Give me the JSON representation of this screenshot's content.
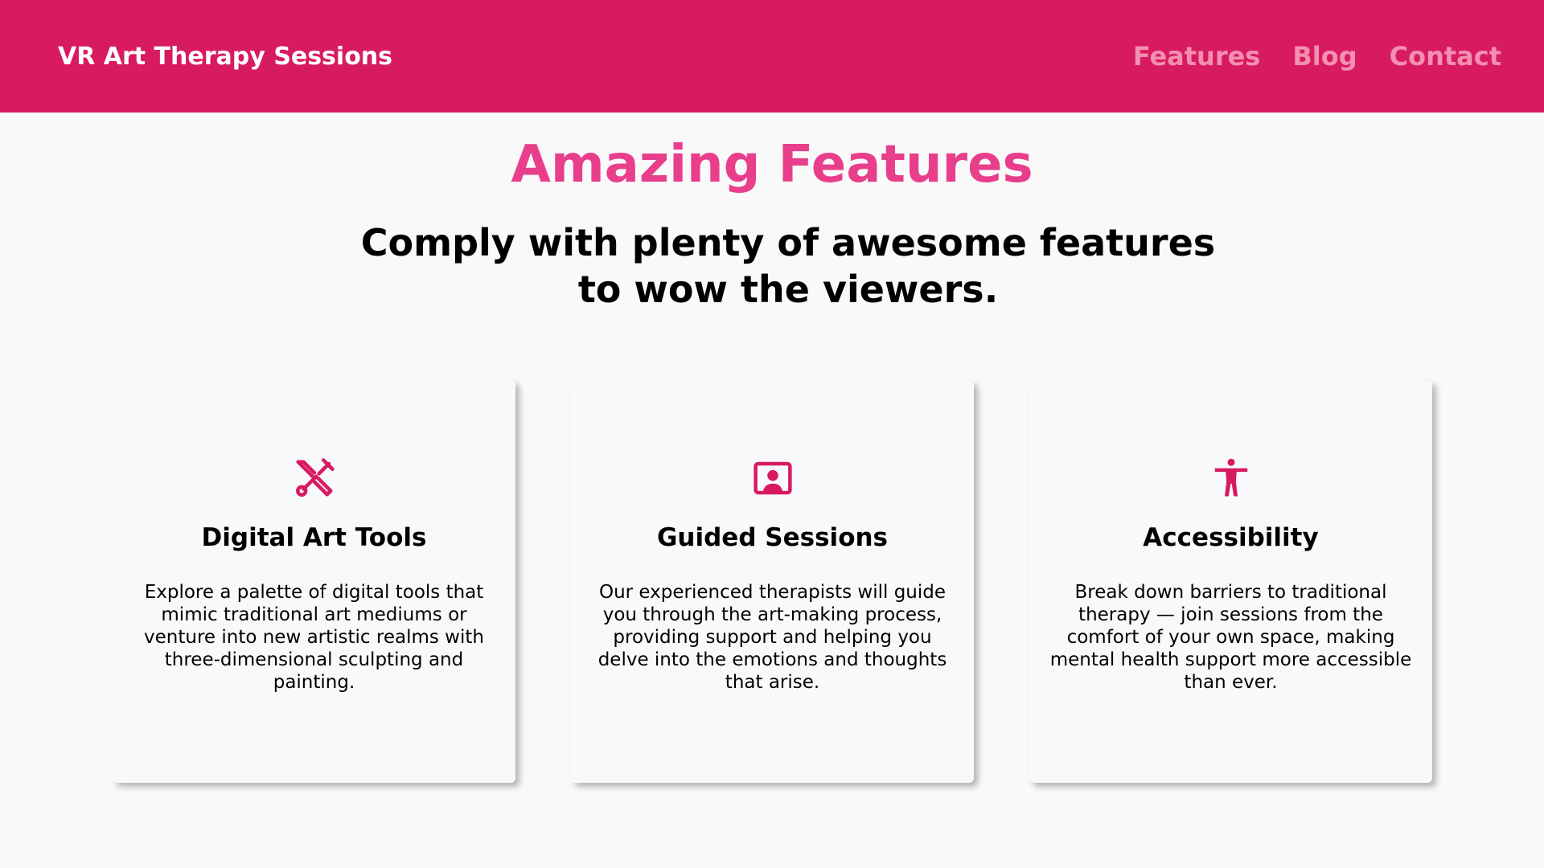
{
  "header": {
    "brand": "VR Art Therapy Sessions",
    "nav": [
      "Features",
      "Blog",
      "Contact"
    ]
  },
  "section": {
    "title": "Amazing Features",
    "subtitle": "Comply with plenty of awesome features to wow the viewers."
  },
  "cards": [
    {
      "icon": "tools-icon",
      "title": "Digital Art Tools",
      "description": "Explore a palette of digital tools that mimic traditional art mediums or venture into new artistic realms with three-dimensional sculpting and painting."
    },
    {
      "icon": "person-frame-icon",
      "title": "Guided Sessions",
      "description": "Our experienced therapists will guide you through the art-making process, providing support and helping you delve into the emotions and thoughts that arise."
    },
    {
      "icon": "accessibility-icon",
      "title": "Accessibility",
      "description": "Break down barriers to traditional therapy — join sessions from the comfort of your own space, making mental health support more accessible than ever."
    }
  ],
  "colors": {
    "header_bg": "#d81b60",
    "nav_link": "#f48fb1",
    "title": "#e83e8c",
    "icon": "#d81b60"
  }
}
